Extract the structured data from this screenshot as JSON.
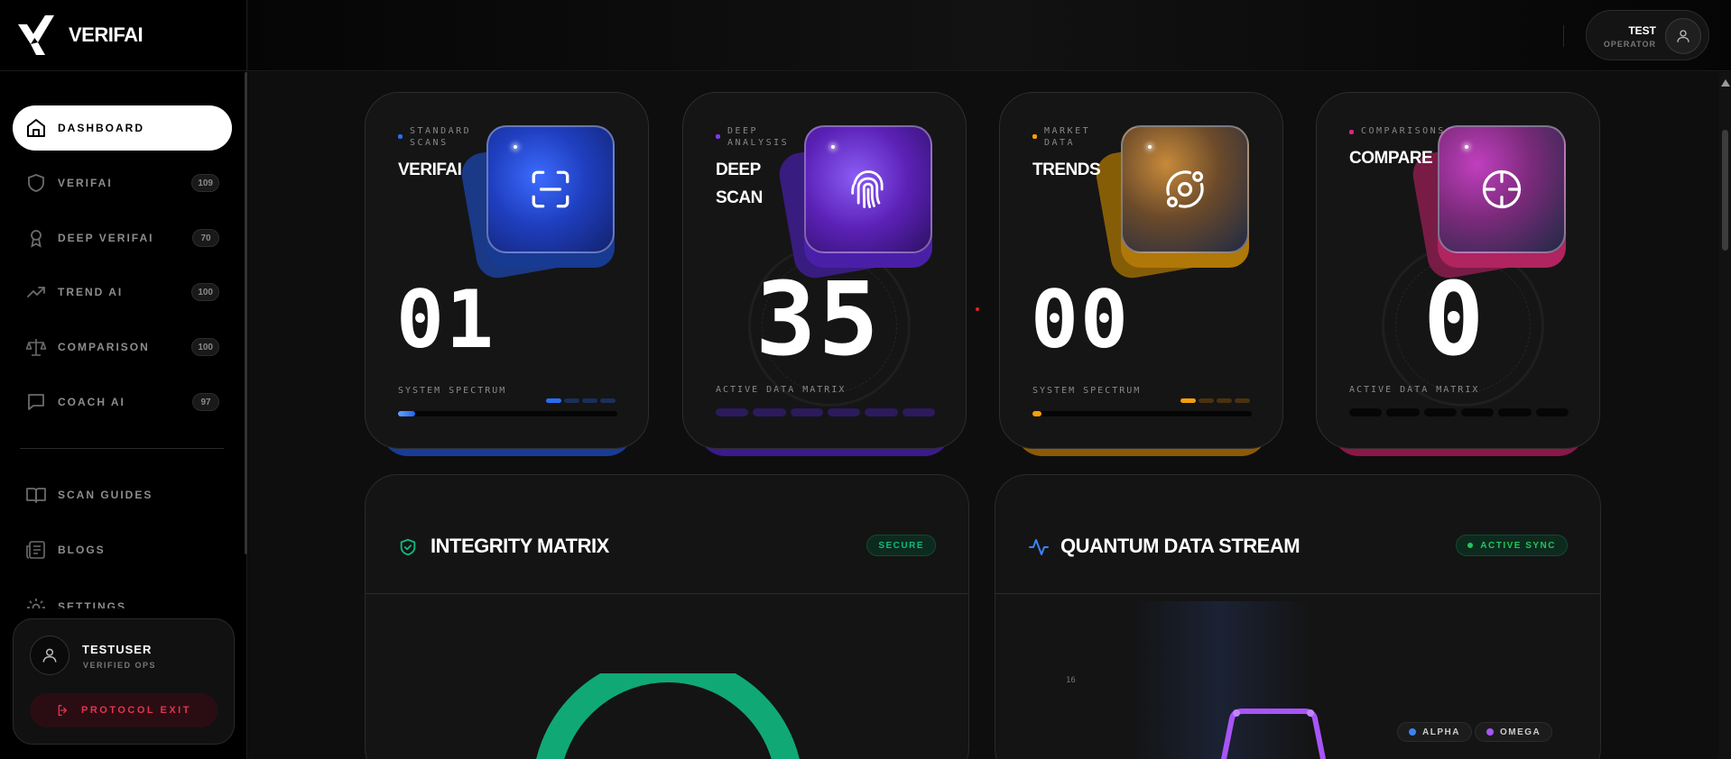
{
  "brand": {
    "name": "VERIFAI"
  },
  "sidebar": {
    "items": [
      {
        "label": "DASHBOARD",
        "badge": "",
        "icon": "home-icon"
      },
      {
        "label": "VERIFAI",
        "badge": "109",
        "icon": "shield-icon"
      },
      {
        "label": "DEEP VERIFAI",
        "badge": "70",
        "icon": "award-icon"
      },
      {
        "label": "TREND AI",
        "badge": "100",
        "icon": "trending-up-icon"
      },
      {
        "label": "COMPARISON",
        "badge": "100",
        "icon": "scale-icon"
      },
      {
        "label": "COACH AI",
        "badge": "97",
        "icon": "message-icon"
      },
      {
        "label": "SCAN GUIDES",
        "badge": "",
        "icon": "book-icon"
      },
      {
        "label": "BLOGS",
        "badge": "",
        "icon": "newspaper-icon"
      },
      {
        "label": "SETTINGS",
        "badge": "",
        "icon": "gear-icon"
      }
    ],
    "user": {
      "name": "TESTUSER",
      "role": "VERIFIED OPS"
    },
    "exit_label": "PROTOCOL EXIT"
  },
  "topbar": {
    "user_name": "TEST",
    "user_role": "OPERATOR"
  },
  "stats": [
    {
      "category": "STANDARD SCANS",
      "title": "VERIFAI",
      "value": "01",
      "footer": "SYSTEM SPECTRUM",
      "accent": "#2a6df0",
      "progress": 0.08
    },
    {
      "category": "DEEP ANALYSIS",
      "title": "DEEP SCAN",
      "value": "35",
      "footer": "ACTIVE DATA MATRIX",
      "accent": "#7c3aed"
    },
    {
      "category": "MARKET DATA",
      "title": "TRENDS",
      "value": "00",
      "footer": "SYSTEM SPECTRUM",
      "accent": "#f59e0b",
      "progress": 0.04
    },
    {
      "category": "COMPARISONS",
      "title": "COMPARE",
      "value": "0",
      "footer": "ACTIVE DATA MATRIX",
      "accent": "#db2777"
    }
  ],
  "panels": {
    "integrity": {
      "title": "INTEGRITY MATRIX",
      "status": "SECURE",
      "color": "#10b981"
    },
    "stream": {
      "title": "QUANTUM DATA STREAM",
      "status": "ACTIVE SYNC",
      "color": "#22c55e",
      "legend": [
        {
          "name": "ALPHA",
          "color": "#3b82f6"
        },
        {
          "name": "OMEGA",
          "color": "#a855f7"
        }
      ],
      "axis_tick": "16"
    }
  }
}
